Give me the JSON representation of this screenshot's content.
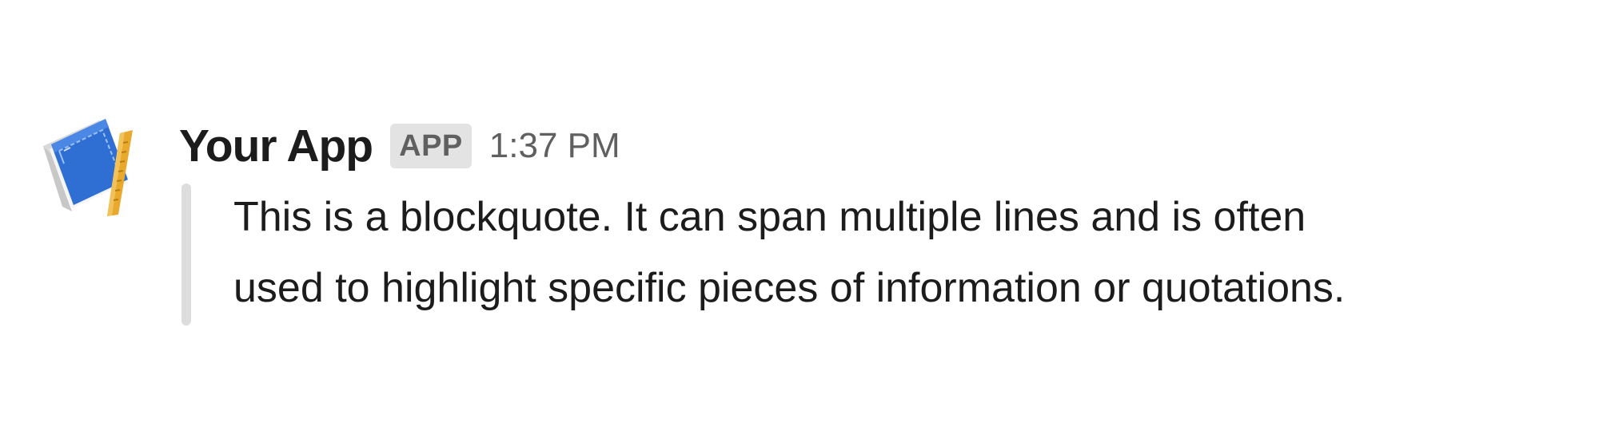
{
  "message": {
    "sender": "Your App",
    "badge": "APP",
    "timestamp": "1:37 PM",
    "avatar_icon": "blueprint-book-icon",
    "blockquote": {
      "lines": [
        "This is a blockquote. It can span multiple lines and is often",
        "used to highlight specific pieces of information or quotations."
      ]
    }
  },
  "colors": {
    "text": "#1d1c1d",
    "muted": "#616061",
    "badge_bg": "#e3e3e3",
    "quote_bar": "#dddddd",
    "avatar_blue": "#2f6fd3",
    "avatar_ruler": "#e8a92c"
  }
}
